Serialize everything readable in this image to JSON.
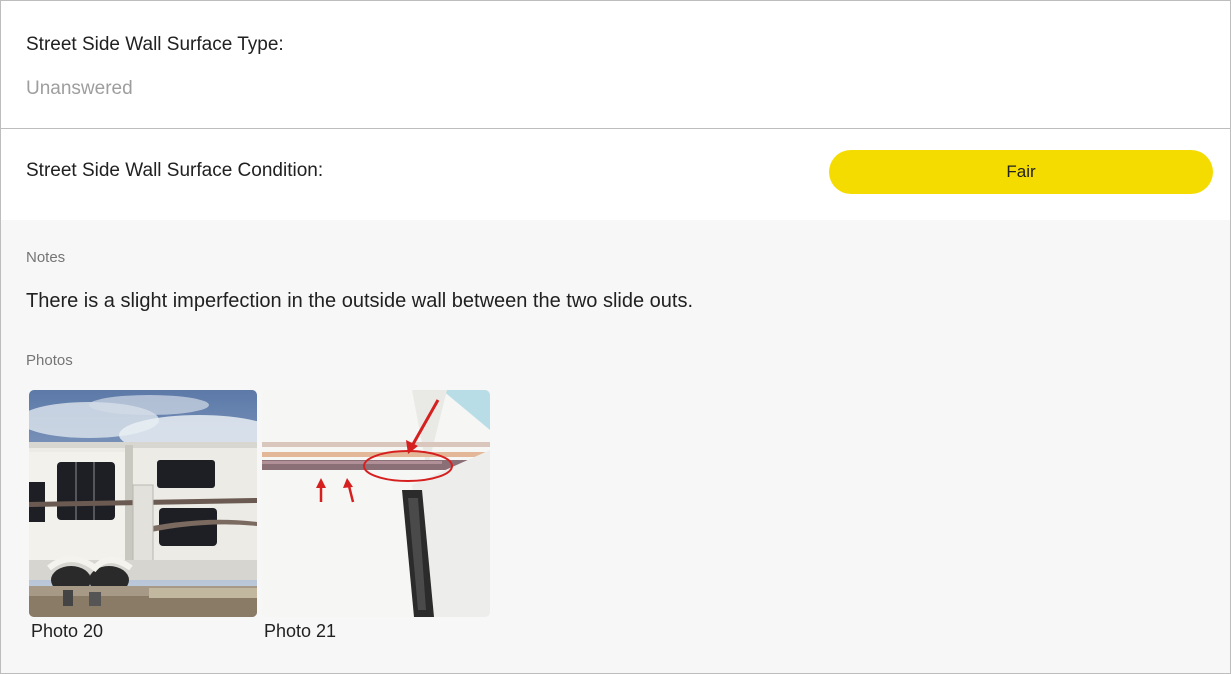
{
  "wall_type": {
    "title": "Street Side Wall Surface Type:",
    "answer": "Unanswered"
  },
  "wall_condition": {
    "title": "Street Side Wall Surface Condition:",
    "rating": "Fair",
    "rating_color": "#f5dc00"
  },
  "notes": {
    "label": "Notes",
    "text": "There is a slight imperfection in the outside wall between the two slide outs."
  },
  "photos": {
    "label": "Photos",
    "items": [
      {
        "caption": "Photo 20"
      },
      {
        "caption": "Photo 21"
      }
    ]
  }
}
